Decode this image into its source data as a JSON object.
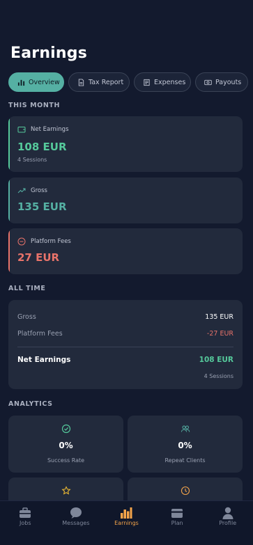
{
  "header": {
    "title": "Earnings"
  },
  "tabs": [
    {
      "label": "Overview",
      "icon": "chart-bar-icon",
      "active": true
    },
    {
      "label": "Tax Report",
      "icon": "document-icon",
      "active": false
    },
    {
      "label": "Expenses",
      "icon": "receipt-icon",
      "active": false
    },
    {
      "label": "Payouts",
      "icon": "cash-icon",
      "active": false
    }
  ],
  "this_month": {
    "label": "THIS MONTH",
    "net": {
      "label": "Net Earnings",
      "value": "108 EUR",
      "sub": "4 Sessions",
      "color": "#55c99b",
      "icon": "wallet-icon"
    },
    "gross": {
      "label": "Gross",
      "value": "135 EUR",
      "color": "#55b0a3",
      "icon": "trending-up-icon"
    },
    "fees": {
      "label": "Platform Fees",
      "value": "27 EUR",
      "color": "#e8736a",
      "icon": "minus-circle-icon"
    }
  },
  "all_time": {
    "label": "ALL TIME",
    "gross_label": "Gross",
    "gross_value": "135 EUR",
    "fees_label": "Platform Fees",
    "fees_value": "-27 EUR",
    "net_label": "Net Earnings",
    "net_value": "108 EUR",
    "sessions": "4 Sessions"
  },
  "analytics": {
    "label": "ANALYTICS",
    "success": {
      "value": "0%",
      "label": "Success Rate",
      "icon": "check-circle-icon"
    },
    "repeat": {
      "value": "0%",
      "label": "Repeat Clients",
      "icon": "users-icon"
    },
    "rating_icon": "star-icon",
    "time_icon": "clock-icon"
  },
  "nav": {
    "jobs": "Jobs",
    "messages": "Messages",
    "earnings": "Earnings",
    "plan": "Plan",
    "profile": "Profile",
    "active_color": "#f4a44a"
  }
}
